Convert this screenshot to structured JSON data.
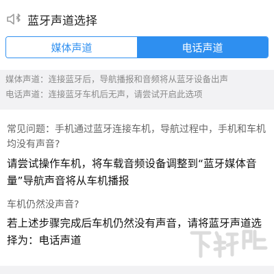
{
  "header": {
    "title": "蓝牙声道选择",
    "icon": "speaker-bluetooth-icon"
  },
  "segmented": {
    "options": [
      "媒体声道",
      "电话声道"
    ],
    "selected_index": 1
  },
  "descriptions": [
    "媒体声道：连接蓝牙后，导航播报和音频将从蓝牙设备出声",
    "电话声道：连接蓝牙车机后无声，请尝试开启此选项"
  ],
  "faq": [
    {
      "question": "常见问题：手机通过蓝牙连接车机，导航过程中，手机和车机均没有声音?",
      "answer": "请尝试操作车机，将车载音频设备调整到“蓝牙媒体音量”导航声音将从车机播报"
    },
    {
      "question": "车机仍然没声音?",
      "answer": "若上述步骤完成后车机仍然没有声音，请将蓝牙声道选择为：电话声道"
    }
  ],
  "watermark": {
    "text": "下载吧"
  },
  "colors": {
    "accent": "#2e8ff0",
    "background": "#f2f2f4"
  }
}
